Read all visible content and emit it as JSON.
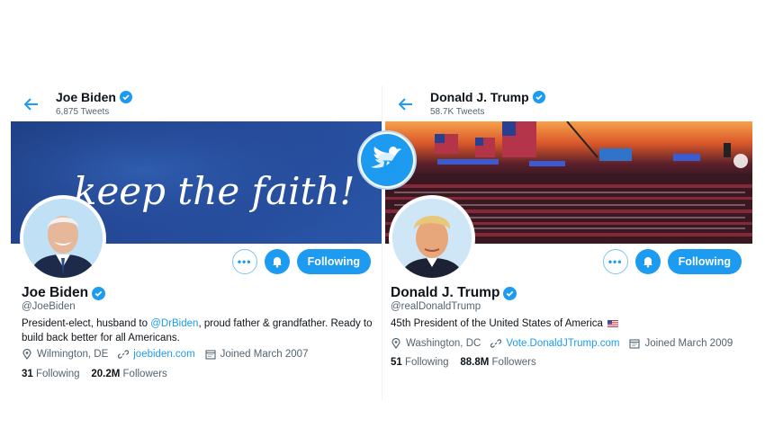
{
  "accent_color": "#1d9bf0",
  "left": {
    "header": {
      "name": "Joe Biden",
      "tweet_count": "6,875 Tweets"
    },
    "banner_text": "keep the faith!",
    "profile": {
      "name": "Joe Biden",
      "handle": "@JoeBiden",
      "bio_before": "President-elect, husband to ",
      "bio_mention": "@DrBiden",
      "bio_after": ", proud father & grandfather. Ready to build back better for all Americans.",
      "location": "Wilmington, DE",
      "website": "joebiden.com",
      "joined": "Joined March 2007",
      "following_count": "31",
      "following_label": "Following",
      "followers_count": "20.2M",
      "followers_label": "Followers"
    },
    "buttons": {
      "more_label": "•••",
      "follow_label": "Following"
    }
  },
  "right": {
    "header": {
      "name": "Donald J. Trump",
      "tweet_count": "58.7K Tweets"
    },
    "profile": {
      "name": "Donald J. Trump",
      "handle": "@realDonaldTrump",
      "bio": "45th President of the United States of America",
      "location": "Washington, DC",
      "website": "Vote.DonaldJTrump.com",
      "joined": "Joined March 2009",
      "following_count": "51",
      "following_label": "Following",
      "followers_count": "88.8M",
      "followers_label": "Followers"
    },
    "buttons": {
      "more_label": "•••",
      "follow_label": "Following"
    }
  },
  "icons": [
    "back-arrow-icon",
    "verified-badge-icon",
    "location-icon",
    "link-icon",
    "calendar-icon",
    "bell-icon",
    "us-flag-icon",
    "twitter-bird-logo"
  ]
}
